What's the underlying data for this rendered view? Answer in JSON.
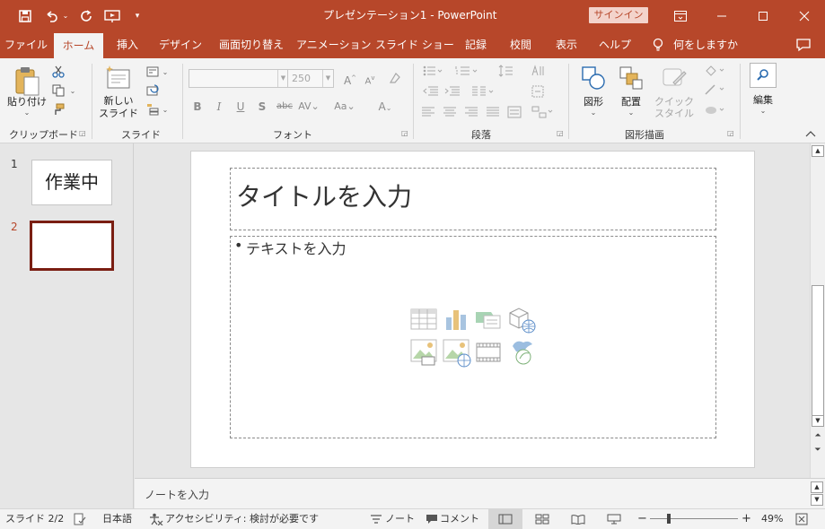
{
  "window": {
    "title": "プレゼンテーション1  -  PowerPoint",
    "signin": "サインイン"
  },
  "tabs": [
    {
      "label": "ファイル"
    },
    {
      "label": "ホーム"
    },
    {
      "label": "挿入"
    },
    {
      "label": "デザイン"
    },
    {
      "label": "画面切り替え"
    },
    {
      "label": "アニメーション"
    },
    {
      "label": "スライド ショー"
    },
    {
      "label": "記録"
    },
    {
      "label": "校閲"
    },
    {
      "label": "表示"
    },
    {
      "label": "ヘルプ"
    }
  ],
  "tell_me": "何をしますか",
  "ribbon": {
    "clipboard": {
      "group": "クリップボード",
      "paste": "貼り付け"
    },
    "slides": {
      "group": "スライド",
      "new_slide_1": "新しい",
      "new_slide_2": "スライド"
    },
    "font": {
      "group": "フォント",
      "size": "250"
    },
    "paragraph": {
      "group": "段落"
    },
    "drawing": {
      "group": "図形描画",
      "shapes": "図形",
      "arrange": "配置",
      "quick_1": "クイック",
      "quick_2": "スタイル"
    },
    "editing": {
      "label": "編集"
    }
  },
  "thumbnails": [
    {
      "number": "1",
      "text": "作業中"
    },
    {
      "number": "2",
      "text": ""
    }
  ],
  "slide": {
    "title_placeholder": "タイトルを入力",
    "body_placeholder": "テキストを入力"
  },
  "notes_placeholder": "ノートを入力",
  "status": {
    "slide": "スライド 2/2",
    "language": "日本語",
    "accessibility": "アクセシビリティ: 検討が必要です",
    "notes": "ノート",
    "comments": "コメント",
    "zoom": "49%",
    "zoom_level": 0.49
  },
  "colors": {
    "accent": "#b7472a",
    "thumb_selected": "#7a1e12"
  }
}
